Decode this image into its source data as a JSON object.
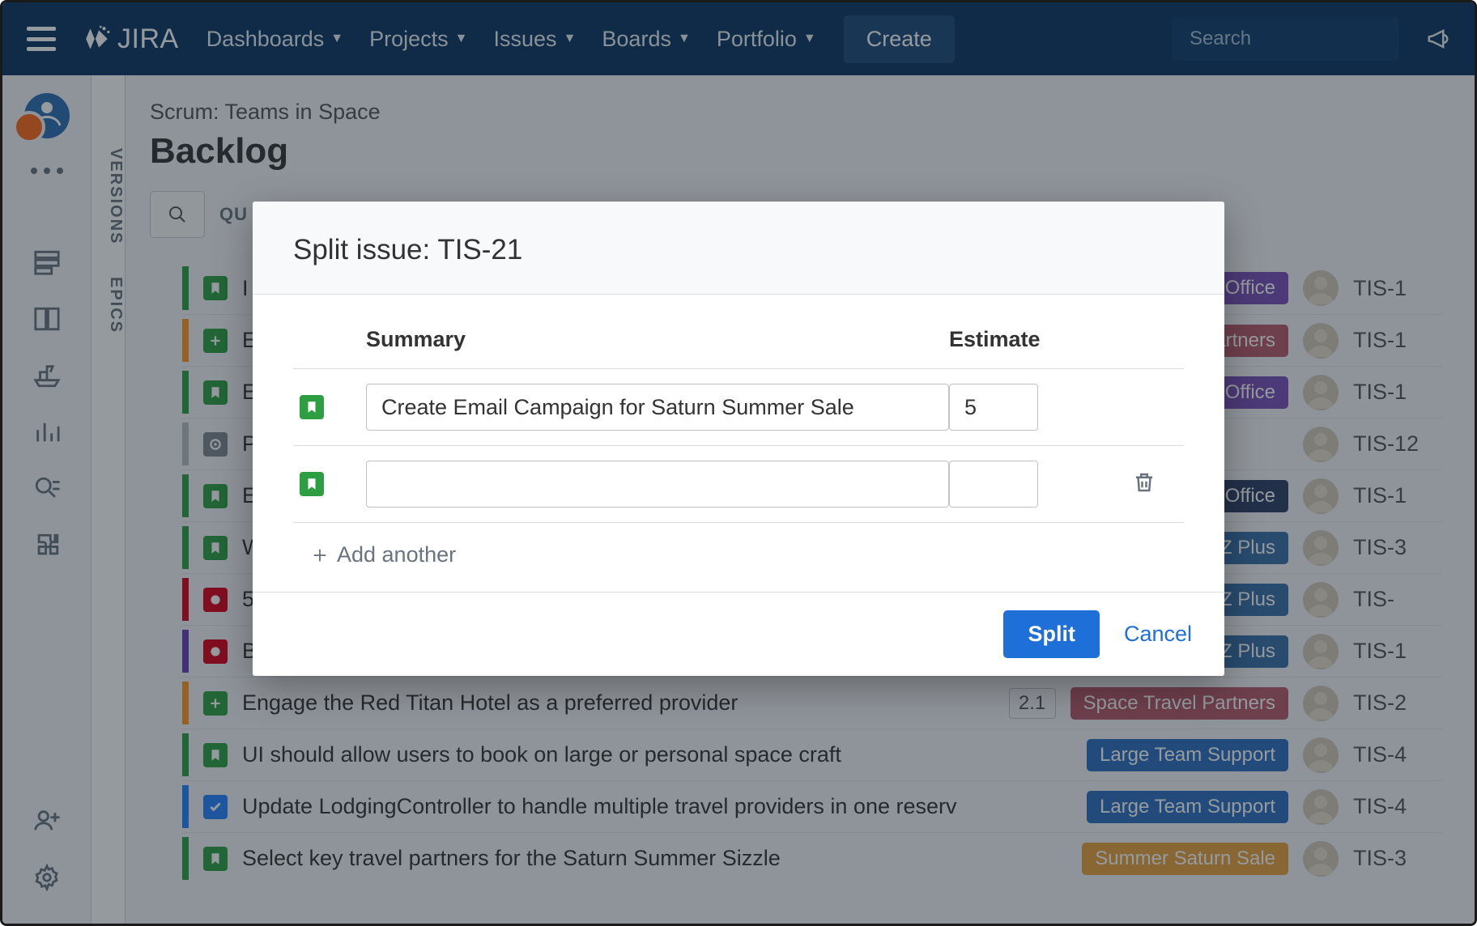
{
  "nav": {
    "logo": "JIRA",
    "items": [
      "Dashboards",
      "Projects",
      "Issues",
      "Boards",
      "Portfolio"
    ],
    "create": "Create",
    "search_placeholder": "Search"
  },
  "sidebar": {
    "vtabs": [
      "VERSIONS",
      "EPICS"
    ]
  },
  "page": {
    "breadcrumb": "Scrum: Teams in Space",
    "title": "Backlog",
    "quick": "QU"
  },
  "backlog": [
    {
      "bar": "green",
      "type": "story",
      "title": "I",
      "epic": "Mars Office",
      "epic_cls": "ep-mars",
      "key": "TIS-1"
    },
    {
      "bar": "orange",
      "type": "add",
      "title": "E",
      "epic": "el Partners",
      "epic_cls": "ep-travel",
      "key": "TIS-1"
    },
    {
      "bar": "green",
      "type": "story",
      "title": "E",
      "epic": "Mars Office",
      "epic_cls": "ep-mars",
      "key": "TIS-1"
    },
    {
      "bar": "gray",
      "type": "target",
      "title": "P",
      "epic": "",
      "epic_cls": "",
      "key": "TIS-12"
    },
    {
      "bar": "green",
      "type": "story",
      "title": "E",
      "epic": "ocal Mars Office",
      "epic_cls": "ep-mars2",
      "key": "TIS-1"
    },
    {
      "bar": "green",
      "type": "story",
      "title": "W",
      "epic": "eeSpaceEZ Plus",
      "epic_cls": "ep-ez",
      "key": "TIS-3"
    },
    {
      "bar": "red",
      "type": "bug",
      "title": "5",
      "epic": "SeeSpaceEZ Plus",
      "epic_cls": "ep-ez",
      "key": "TIS-"
    },
    {
      "bar": "purple",
      "type": "bug",
      "title": "B",
      "epic": "aceEZ Plus",
      "epic_cls": "ep-ez",
      "key": "TIS-1"
    },
    {
      "bar": "orange",
      "type": "add",
      "title": "Engage the Red Titan Hotel as a preferred provider",
      "est": "2.1",
      "epic": "Space Travel Partners",
      "epic_cls": "ep-travel",
      "key": "TIS-2"
    },
    {
      "bar": "green",
      "type": "story",
      "title": "UI should allow users to book on large or personal space craft",
      "epic": "Large Team Support",
      "epic_cls": "ep-large",
      "key": "TIS-4"
    },
    {
      "bar": "blue",
      "type": "task",
      "title": "Update LodgingController to handle multiple travel providers in one reserv",
      "epic": "Large Team Support",
      "epic_cls": "ep-large",
      "key": "TIS-4"
    },
    {
      "bar": "green",
      "type": "story",
      "title": "Select key travel partners for the Saturn Summer Sizzle",
      "epic": "Summer Saturn Sale",
      "epic_cls": "ep-saturn",
      "key": "TIS-3"
    }
  ],
  "modal": {
    "title": "Split issue: TIS-21",
    "col_summary": "Summary",
    "col_estimate": "Estimate",
    "rows": [
      {
        "summary": "Create Email Campaign for Saturn Summer Sale",
        "estimate": "5",
        "deletable": false
      },
      {
        "summary": "",
        "estimate": "",
        "deletable": true
      }
    ],
    "add_another": "Add another",
    "split": "Split",
    "cancel": "Cancel"
  }
}
